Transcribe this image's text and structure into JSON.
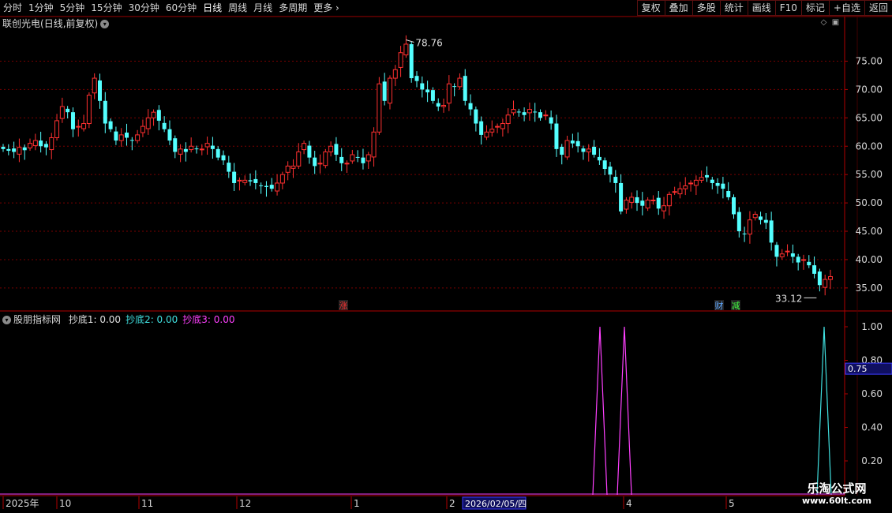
{
  "toolbar": {
    "periods": [
      "分时",
      "1分钟",
      "5分钟",
      "15分钟",
      "30分钟",
      "60分钟",
      "日线",
      "周线",
      "月线",
      "多周期",
      "更多"
    ],
    "active_period": "日线",
    "more_chevron": "›",
    "buttons": [
      "复权",
      "叠加",
      "多股",
      "统计",
      "画线",
      "F10",
      "标记",
      "+自选",
      "返回"
    ]
  },
  "main_chart": {
    "stock_name": "联创光电",
    "period_info": "(日线,前复权)",
    "y_axis_labels": [
      "75.00",
      "70.00",
      "65.00",
      "60.00",
      "55.00",
      "50.00",
      "45.00",
      "40.00",
      "35.00"
    ],
    "high_annotation": "78.76",
    "low_annotation": "33.12",
    "markers": [
      {
        "text": "涨",
        "color": "#ff3333"
      },
      {
        "text": "财",
        "color": "#5fa8ff"
      },
      {
        "text": "减",
        "color": "#44ff44"
      }
    ],
    "colors": {
      "up": "#ff3030",
      "down": "#54ffff",
      "grid": "#7a0000"
    }
  },
  "indicator": {
    "name": "股朋指标网",
    "lines": [
      {
        "label": "抄底1:",
        "value": "0.00",
        "color": "#e0e0e0"
      },
      {
        "label": "抄底2:",
        "value": "0.00",
        "color": "#40e0e0"
      },
      {
        "label": "抄底3:",
        "value": "0.00",
        "color": "#ff40ff"
      }
    ],
    "y_axis_labels": [
      "1.00",
      "0.80",
      "0.60",
      "0.40",
      "0.20"
    ],
    "cursor_value": "0.75"
  },
  "x_axis": {
    "labels": [
      "2025年",
      "10",
      "11",
      "12",
      "1",
      "2",
      "4",
      "5"
    ],
    "cursor_date": "2026/02/05/四"
  },
  "watermark": {
    "line1": "乐淘公式网",
    "line2": "www.60lt.com"
  },
  "chart_data": {
    "type": "candlestick",
    "title": "联创光电(日线,前复权)",
    "ylim": [
      31.5,
      80.5
    ],
    "close_prices": [
      59.5,
      59.2,
      59.0,
      59.8,
      59.3,
      60.5,
      61.0,
      60.0,
      59.8,
      61.5,
      64.5,
      67.0,
      66.0,
      63.0,
      63.5,
      64.0,
      69.0,
      72.0,
      68.0,
      64.0,
      63.0,
      61.0,
      62.0,
      61.5,
      61.0,
      62.0,
      63.5,
      65.0,
      66.0,
      64.5,
      63.0,
      61.0,
      59.0,
      59.5,
      59.0,
      60.0,
      59.5,
      59.5,
      60.5,
      59.5,
      58.0,
      57.5,
      55.5,
      53.5,
      54.0,
      54.0,
      53.8,
      53.5,
      53.0,
      52.8,
      52.5,
      53.5,
      55.0,
      56.5,
      56.5,
      59.0,
      60.5,
      58.0,
      56.5,
      57.0,
      59.0,
      60.0,
      58.5,
      57.0,
      57.0,
      58.5,
      58.0,
      57.0,
      58.5,
      62.5,
      71.0,
      68.0,
      72.0,
      73.5,
      76.5,
      78.0,
      72.0,
      71.5,
      70.0,
      69.5,
      68.0,
      67.0,
      67.2,
      71.0,
      70.5,
      72.0,
      68.0,
      66.5,
      64.0,
      62.0,
      62.5,
      63.0,
      63.5,
      64.0,
      65.5,
      66.5,
      66.0,
      65.5,
      66.5,
      66.0,
      65.0,
      65.5,
      64.0,
      59.5,
      58.5,
      61.0,
      60.5,
      60.0,
      59.0,
      59.5,
      58.5,
      57.5,
      56.0,
      55.0,
      53.5,
      48.5,
      50.5,
      51.0,
      50.0,
      49.5,
      50.5,
      50.5,
      49.0,
      49.5,
      51.5,
      52.0,
      52.5,
      53.0,
      53.5,
      54.0,
      54.5,
      54.5,
      53.5,
      53.0,
      52.5,
      51.0,
      48.0,
      45.0,
      44.5,
      47.0,
      48.0,
      47.0,
      46.5,
      43.0,
      40.5,
      41.0,
      41.5,
      40.5,
      39.5,
      40.0,
      39.0,
      37.5,
      35.5,
      36.5,
      37.0
    ]
  }
}
